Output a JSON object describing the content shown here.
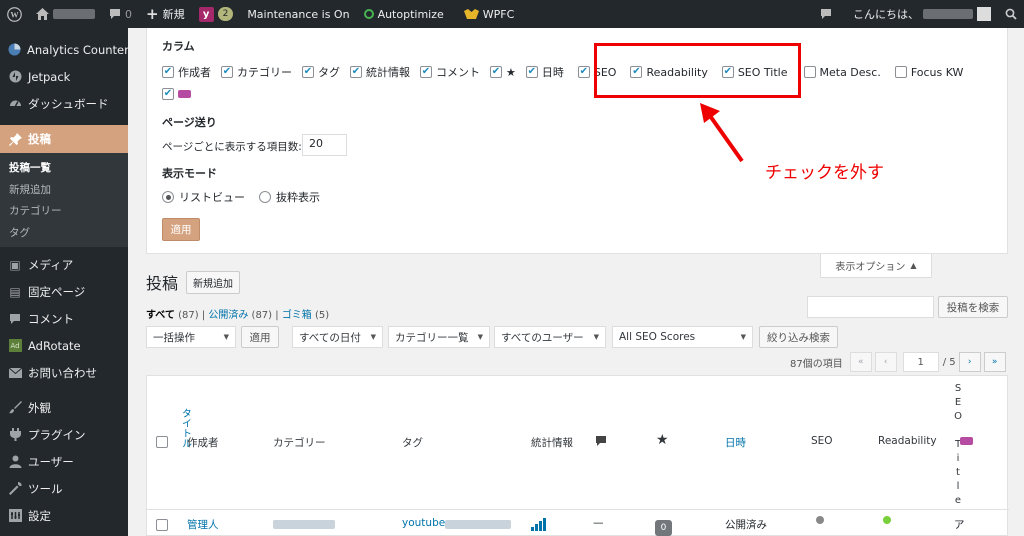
{
  "adminbar": {
    "comment_count": "0",
    "new_label": "新規",
    "yoast_count": "2",
    "maintenance": "Maintenance is On",
    "autoptimize": "Autoptimize",
    "wpfc": "WPFC",
    "greeting": "こんにちは、"
  },
  "sidebar": {
    "items": [
      {
        "label": "Analytics Counter",
        "icon": "analytics-icon"
      },
      {
        "label": "Jetpack",
        "icon": "jetpack-icon"
      },
      {
        "label": "ダッシュボード",
        "icon": "dashboard-icon"
      },
      {
        "label": "投稿",
        "icon": "pin-icon"
      },
      {
        "label": "メディア",
        "icon": "media-icon"
      },
      {
        "label": "固定ページ",
        "icon": "page-icon"
      },
      {
        "label": "コメント",
        "icon": "comment-icon"
      },
      {
        "label": "AdRotate",
        "icon": "adrotate-icon"
      },
      {
        "label": "お問い合わせ",
        "icon": "mail-icon"
      },
      {
        "label": "外観",
        "icon": "brush-icon"
      },
      {
        "label": "プラグイン",
        "icon": "plugin-icon"
      },
      {
        "label": "ユーザー",
        "icon": "user-icon"
      },
      {
        "label": "ツール",
        "icon": "wrench-icon"
      },
      {
        "label": "設定",
        "icon": "settings-icon"
      }
    ],
    "submenu": [
      "投稿一覧",
      "新規追加",
      "カテゴリー",
      "タグ"
    ]
  },
  "screen_options": {
    "columns_title": "カラム",
    "columns": [
      {
        "label": "作成者",
        "checked": true
      },
      {
        "label": "カテゴリー",
        "checked": true
      },
      {
        "label": "タグ",
        "checked": true
      },
      {
        "label": "統計情報",
        "checked": true
      },
      {
        "label": "コメント",
        "checked": true
      },
      {
        "label": "★",
        "checked": true
      },
      {
        "label": "日時",
        "checked": true
      },
      {
        "label": "SEO",
        "checked": true
      },
      {
        "label": "Readability",
        "checked": true
      },
      {
        "label": "SEO Title",
        "checked": true
      },
      {
        "label": "Meta Desc.",
        "checked": false
      },
      {
        "label": "Focus KW",
        "checked": false
      }
    ],
    "pagination_title": "ページ送り",
    "per_page_label": "ページごとに表示する項目数:",
    "per_page_value": "20",
    "view_mode_title": "表示モード",
    "view_list": "リストビュー",
    "view_excerpt": "抜粋表示",
    "apply": "適用",
    "annotation": "チェックを外す",
    "tab_label": "表示オプション"
  },
  "posts": {
    "title": "投稿",
    "add_new": "新規追加",
    "filter_all": "すべて",
    "filter_all_count": "(87)",
    "filter_published": "公開済み",
    "filter_published_count": "(87)",
    "filter_trash": "ゴミ箱",
    "filter_trash_count": "(5)",
    "search_button": "投稿を検索",
    "bulk_action": "一括操作",
    "apply": "適用",
    "all_dates": "すべての日付",
    "all_categories": "カテゴリー一覧",
    "all_users": "すべてのユーザー",
    "all_seo": "All SEO Scores",
    "filter_button": "絞り込み検索",
    "item_count": "87個の項目",
    "page_current": "1",
    "page_total": "/ 5"
  },
  "table": {
    "col_title": "タイトル",
    "col_author": "作成者",
    "col_category": "カテゴリー",
    "col_tags": "タグ",
    "col_stats": "統計情報",
    "col_date": "日時",
    "col_seo": "SEO",
    "col_readability": "Readability",
    "col_seo_title": "SEO Title",
    "row_author": "管理人",
    "row_tags": "youtube,",
    "row_comments": "0",
    "row_date": "公開済み",
    "row_dash": "—",
    "row_title_fragment": "ア",
    "colors": {
      "seo_dot": "#888888",
      "readability_dot": "#7ad03a"
    }
  }
}
